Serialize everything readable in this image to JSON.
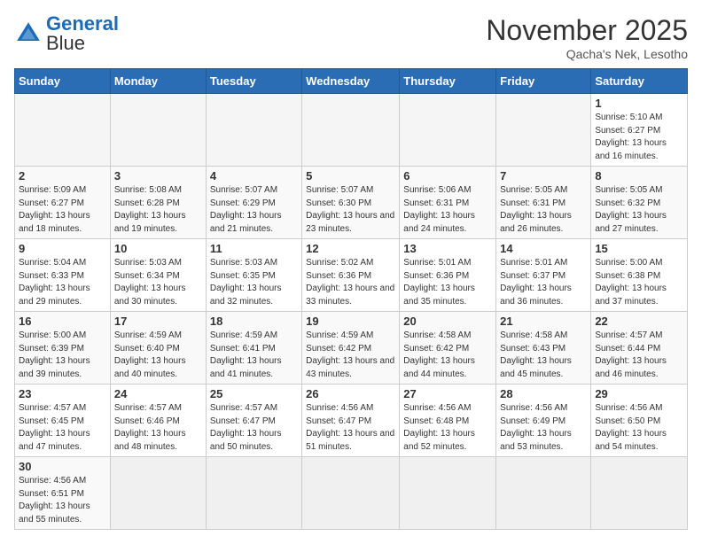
{
  "header": {
    "logo_general": "General",
    "logo_blue": "Blue",
    "month_title": "November 2025",
    "subtitle": "Qacha's Nek, Lesotho"
  },
  "weekdays": [
    "Sunday",
    "Monday",
    "Tuesday",
    "Wednesday",
    "Thursday",
    "Friday",
    "Saturday"
  ],
  "weeks": [
    [
      {
        "day": "",
        "info": ""
      },
      {
        "day": "",
        "info": ""
      },
      {
        "day": "",
        "info": ""
      },
      {
        "day": "",
        "info": ""
      },
      {
        "day": "",
        "info": ""
      },
      {
        "day": "",
        "info": ""
      },
      {
        "day": "1",
        "info": "Sunrise: 5:10 AM\nSunset: 6:27 PM\nDaylight: 13 hours and 16 minutes."
      }
    ],
    [
      {
        "day": "2",
        "info": "Sunrise: 5:09 AM\nSunset: 6:27 PM\nDaylight: 13 hours and 18 minutes."
      },
      {
        "day": "3",
        "info": "Sunrise: 5:08 AM\nSunset: 6:28 PM\nDaylight: 13 hours and 19 minutes."
      },
      {
        "day": "4",
        "info": "Sunrise: 5:07 AM\nSunset: 6:29 PM\nDaylight: 13 hours and 21 minutes."
      },
      {
        "day": "5",
        "info": "Sunrise: 5:07 AM\nSunset: 6:30 PM\nDaylight: 13 hours and 23 minutes."
      },
      {
        "day": "6",
        "info": "Sunrise: 5:06 AM\nSunset: 6:31 PM\nDaylight: 13 hours and 24 minutes."
      },
      {
        "day": "7",
        "info": "Sunrise: 5:05 AM\nSunset: 6:31 PM\nDaylight: 13 hours and 26 minutes."
      },
      {
        "day": "8",
        "info": "Sunrise: 5:05 AM\nSunset: 6:32 PM\nDaylight: 13 hours and 27 minutes."
      }
    ],
    [
      {
        "day": "9",
        "info": "Sunrise: 5:04 AM\nSunset: 6:33 PM\nDaylight: 13 hours and 29 minutes."
      },
      {
        "day": "10",
        "info": "Sunrise: 5:03 AM\nSunset: 6:34 PM\nDaylight: 13 hours and 30 minutes."
      },
      {
        "day": "11",
        "info": "Sunrise: 5:03 AM\nSunset: 6:35 PM\nDaylight: 13 hours and 32 minutes."
      },
      {
        "day": "12",
        "info": "Sunrise: 5:02 AM\nSunset: 6:36 PM\nDaylight: 13 hours and 33 minutes."
      },
      {
        "day": "13",
        "info": "Sunrise: 5:01 AM\nSunset: 6:36 PM\nDaylight: 13 hours and 35 minutes."
      },
      {
        "day": "14",
        "info": "Sunrise: 5:01 AM\nSunset: 6:37 PM\nDaylight: 13 hours and 36 minutes."
      },
      {
        "day": "15",
        "info": "Sunrise: 5:00 AM\nSunset: 6:38 PM\nDaylight: 13 hours and 37 minutes."
      }
    ],
    [
      {
        "day": "16",
        "info": "Sunrise: 5:00 AM\nSunset: 6:39 PM\nDaylight: 13 hours and 39 minutes."
      },
      {
        "day": "17",
        "info": "Sunrise: 4:59 AM\nSunset: 6:40 PM\nDaylight: 13 hours and 40 minutes."
      },
      {
        "day": "18",
        "info": "Sunrise: 4:59 AM\nSunset: 6:41 PM\nDaylight: 13 hours and 41 minutes."
      },
      {
        "day": "19",
        "info": "Sunrise: 4:59 AM\nSunset: 6:42 PM\nDaylight: 13 hours and 43 minutes."
      },
      {
        "day": "20",
        "info": "Sunrise: 4:58 AM\nSunset: 6:42 PM\nDaylight: 13 hours and 44 minutes."
      },
      {
        "day": "21",
        "info": "Sunrise: 4:58 AM\nSunset: 6:43 PM\nDaylight: 13 hours and 45 minutes."
      },
      {
        "day": "22",
        "info": "Sunrise: 4:57 AM\nSunset: 6:44 PM\nDaylight: 13 hours and 46 minutes."
      }
    ],
    [
      {
        "day": "23",
        "info": "Sunrise: 4:57 AM\nSunset: 6:45 PM\nDaylight: 13 hours and 47 minutes."
      },
      {
        "day": "24",
        "info": "Sunrise: 4:57 AM\nSunset: 6:46 PM\nDaylight: 13 hours and 48 minutes."
      },
      {
        "day": "25",
        "info": "Sunrise: 4:57 AM\nSunset: 6:47 PM\nDaylight: 13 hours and 50 minutes."
      },
      {
        "day": "26",
        "info": "Sunrise: 4:56 AM\nSunset: 6:47 PM\nDaylight: 13 hours and 51 minutes."
      },
      {
        "day": "27",
        "info": "Sunrise: 4:56 AM\nSunset: 6:48 PM\nDaylight: 13 hours and 52 minutes."
      },
      {
        "day": "28",
        "info": "Sunrise: 4:56 AM\nSunset: 6:49 PM\nDaylight: 13 hours and 53 minutes."
      },
      {
        "day": "29",
        "info": "Sunrise: 4:56 AM\nSunset: 6:50 PM\nDaylight: 13 hours and 54 minutes."
      }
    ],
    [
      {
        "day": "30",
        "info": "Sunrise: 4:56 AM\nSunset: 6:51 PM\nDaylight: 13 hours and 55 minutes."
      },
      {
        "day": "",
        "info": ""
      },
      {
        "day": "",
        "info": ""
      },
      {
        "day": "",
        "info": ""
      },
      {
        "day": "",
        "info": ""
      },
      {
        "day": "",
        "info": ""
      },
      {
        "day": "",
        "info": ""
      }
    ]
  ]
}
